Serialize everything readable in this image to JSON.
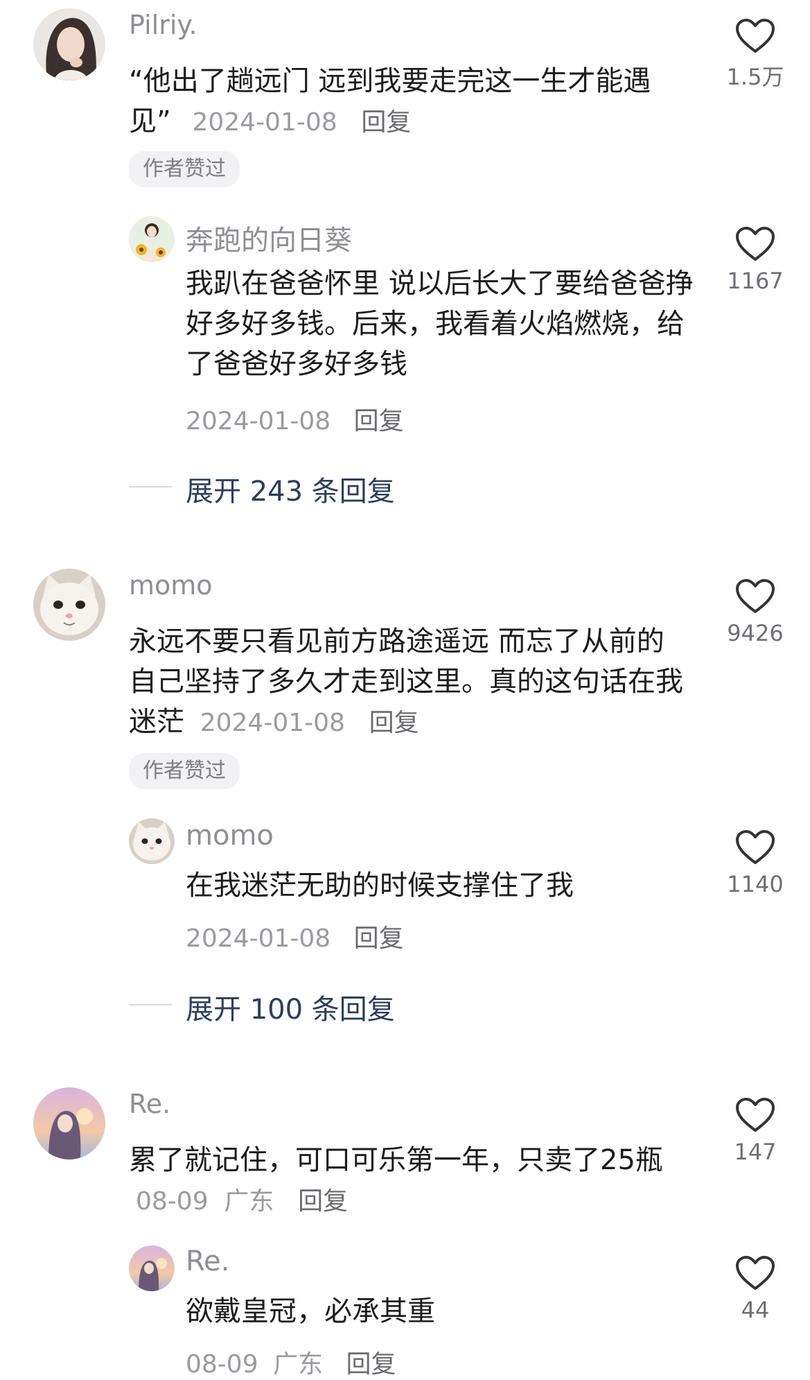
{
  "comments": [
    {
      "author": "Pilriy.",
      "avatar_icon": "woman-portrait-avatar",
      "text": "“他出了趟远门 远到我要走完这一生才能遇见”",
      "date": "2024-01-08",
      "reply_label": "回复",
      "author_liked_badge": "作者赞过",
      "likes": "1.5万",
      "replies": [
        {
          "author": "奔跑的向日葵",
          "avatar_icon": "girl-with-sunflowers-avatar",
          "text": "我趴在爸爸怀里 说以后长大了要给爸爸挣好多好多钱。后来，我看着火焰燃烧，给了爸爸好多好多钱",
          "date": "2024-01-08",
          "reply_label": "回复",
          "likes": "1167"
        }
      ],
      "expand_label": "展开 243 条回复"
    },
    {
      "author": "momo",
      "avatar_icon": "cat-face-avatar",
      "text": "永远不要只看见前方路途遥远 而忘了从前的自己坚持了多久才走到这里。真的这句话在我迷茫",
      "date": "2024-01-08",
      "reply_label": "回复",
      "author_liked_badge": "作者赞过",
      "likes": "9426",
      "replies": [
        {
          "author": "momo",
          "avatar_icon": "cat-face-avatar",
          "text": "在我迷茫无助的时候支撑住了我",
          "date": "2024-01-08",
          "reply_label": "回复",
          "likes": "1140"
        }
      ],
      "expand_label": "展开 100 条回复"
    },
    {
      "author": "Re.",
      "avatar_icon": "sunset-girl-avatar",
      "text": "累了就记住，可口可乐第一年，只卖了25瓶",
      "date": "08-09",
      "location": "广东",
      "reply_label": "回复",
      "likes": "147",
      "replies": [
        {
          "author": "Re.",
          "avatar_icon": "sunset-girl-avatar",
          "text": "欲戴皇冠，必承其重",
          "date": "08-09",
          "location": "广东",
          "reply_label": "回复",
          "likes": "44"
        }
      ]
    }
  ],
  "colors": {
    "background": "#ffffff",
    "name": "#8e8e93",
    "text": "#1c1c1e",
    "meta": "#9a9aa0",
    "expand_link": "#2c3e5a",
    "badge_bg": "#f2f2f4"
  }
}
